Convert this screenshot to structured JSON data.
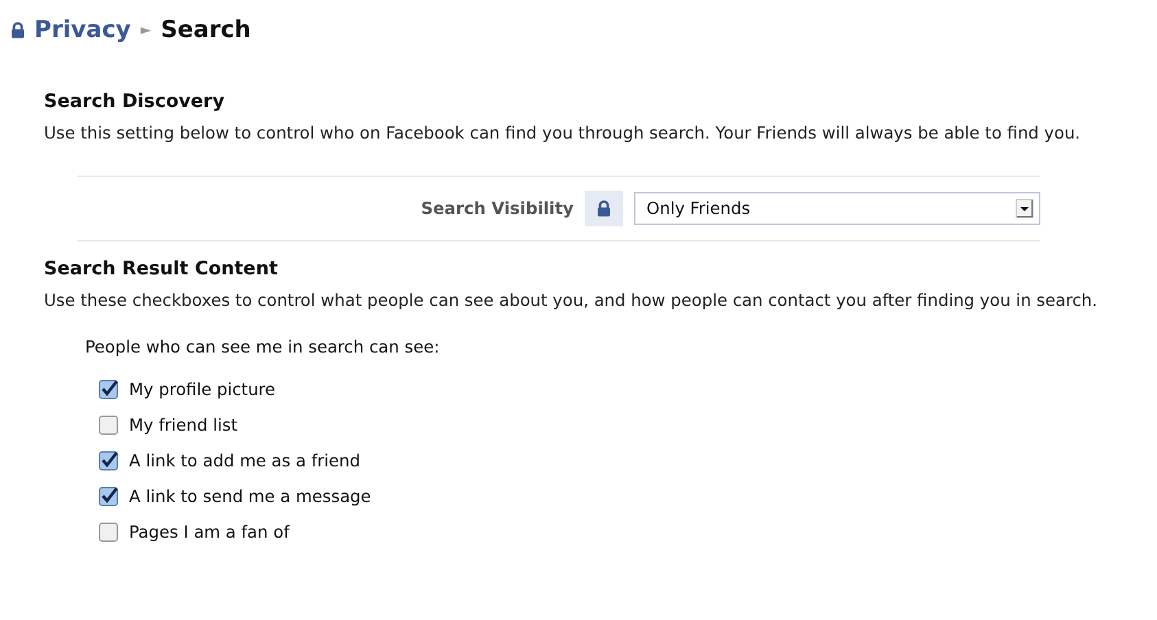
{
  "breadcrumb": {
    "parent": "Privacy",
    "separator": "►",
    "current": "Search"
  },
  "search_discovery": {
    "heading": "Search Discovery",
    "description": "Use this setting below to control who on Facebook can find you through search. Your Friends will always be able to find you.",
    "visibility": {
      "label": "Search Visibility",
      "value": "Only Friends"
    }
  },
  "search_result_content": {
    "heading": "Search Result Content",
    "description": "Use these checkboxes to control what people can see about you, and how people can contact you after finding you in search.",
    "prompt": "People who can see me in search can see:",
    "options": [
      {
        "label": "My profile picture",
        "checked": true
      },
      {
        "label": "My friend list",
        "checked": false
      },
      {
        "label": "A link to add me as a friend",
        "checked": true
      },
      {
        "label": "A link to send me a message",
        "checked": true
      },
      {
        "label": "Pages I am a fan of",
        "checked": false
      }
    ]
  }
}
